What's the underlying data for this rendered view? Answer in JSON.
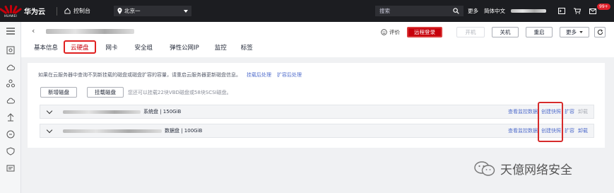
{
  "topbar": {
    "brand_logo_text": "HUAWEI",
    "brand": "华为云",
    "console": "控制台",
    "region": "北京一",
    "search_placeholder": "搜索",
    "more": "更多",
    "lang": "简体中文",
    "badge": "99+"
  },
  "header": {
    "rate": "评价",
    "remote_login": "远程登录",
    "start": "开机",
    "shutdown": "关机",
    "restart": "重启",
    "more": "更多"
  },
  "tabs": [
    "基本信息",
    "云硬盘",
    "网卡",
    "安全组",
    "弹性公网IP",
    "监控",
    "标签"
  ],
  "notice": {
    "text": "如果在云服务器中查询不到新挂载的磁盘或磁盘扩容的容量，请重启云服务器更新磁盘信息。",
    "link1": "挂载后处理",
    "link2": "扩容后处理"
  },
  "buttons": {
    "add_disk": "新增磁盘",
    "attach_disk": "挂载磁盘",
    "hint": "您还可以挂载22块VBD磁盘或58块SCSI磁盘。"
  },
  "disks": [
    {
      "type": "系统盘 | 150GiB",
      "actions": [
        "查看监控数据",
        "创建快照",
        "扩容",
        "卸载"
      ]
    },
    {
      "type": "数据盘 | 100GiB",
      "actions": [
        "查看监控数据",
        "创建快照",
        "扩容",
        "卸载"
      ]
    }
  ],
  "watermark": "天億网络安全"
}
